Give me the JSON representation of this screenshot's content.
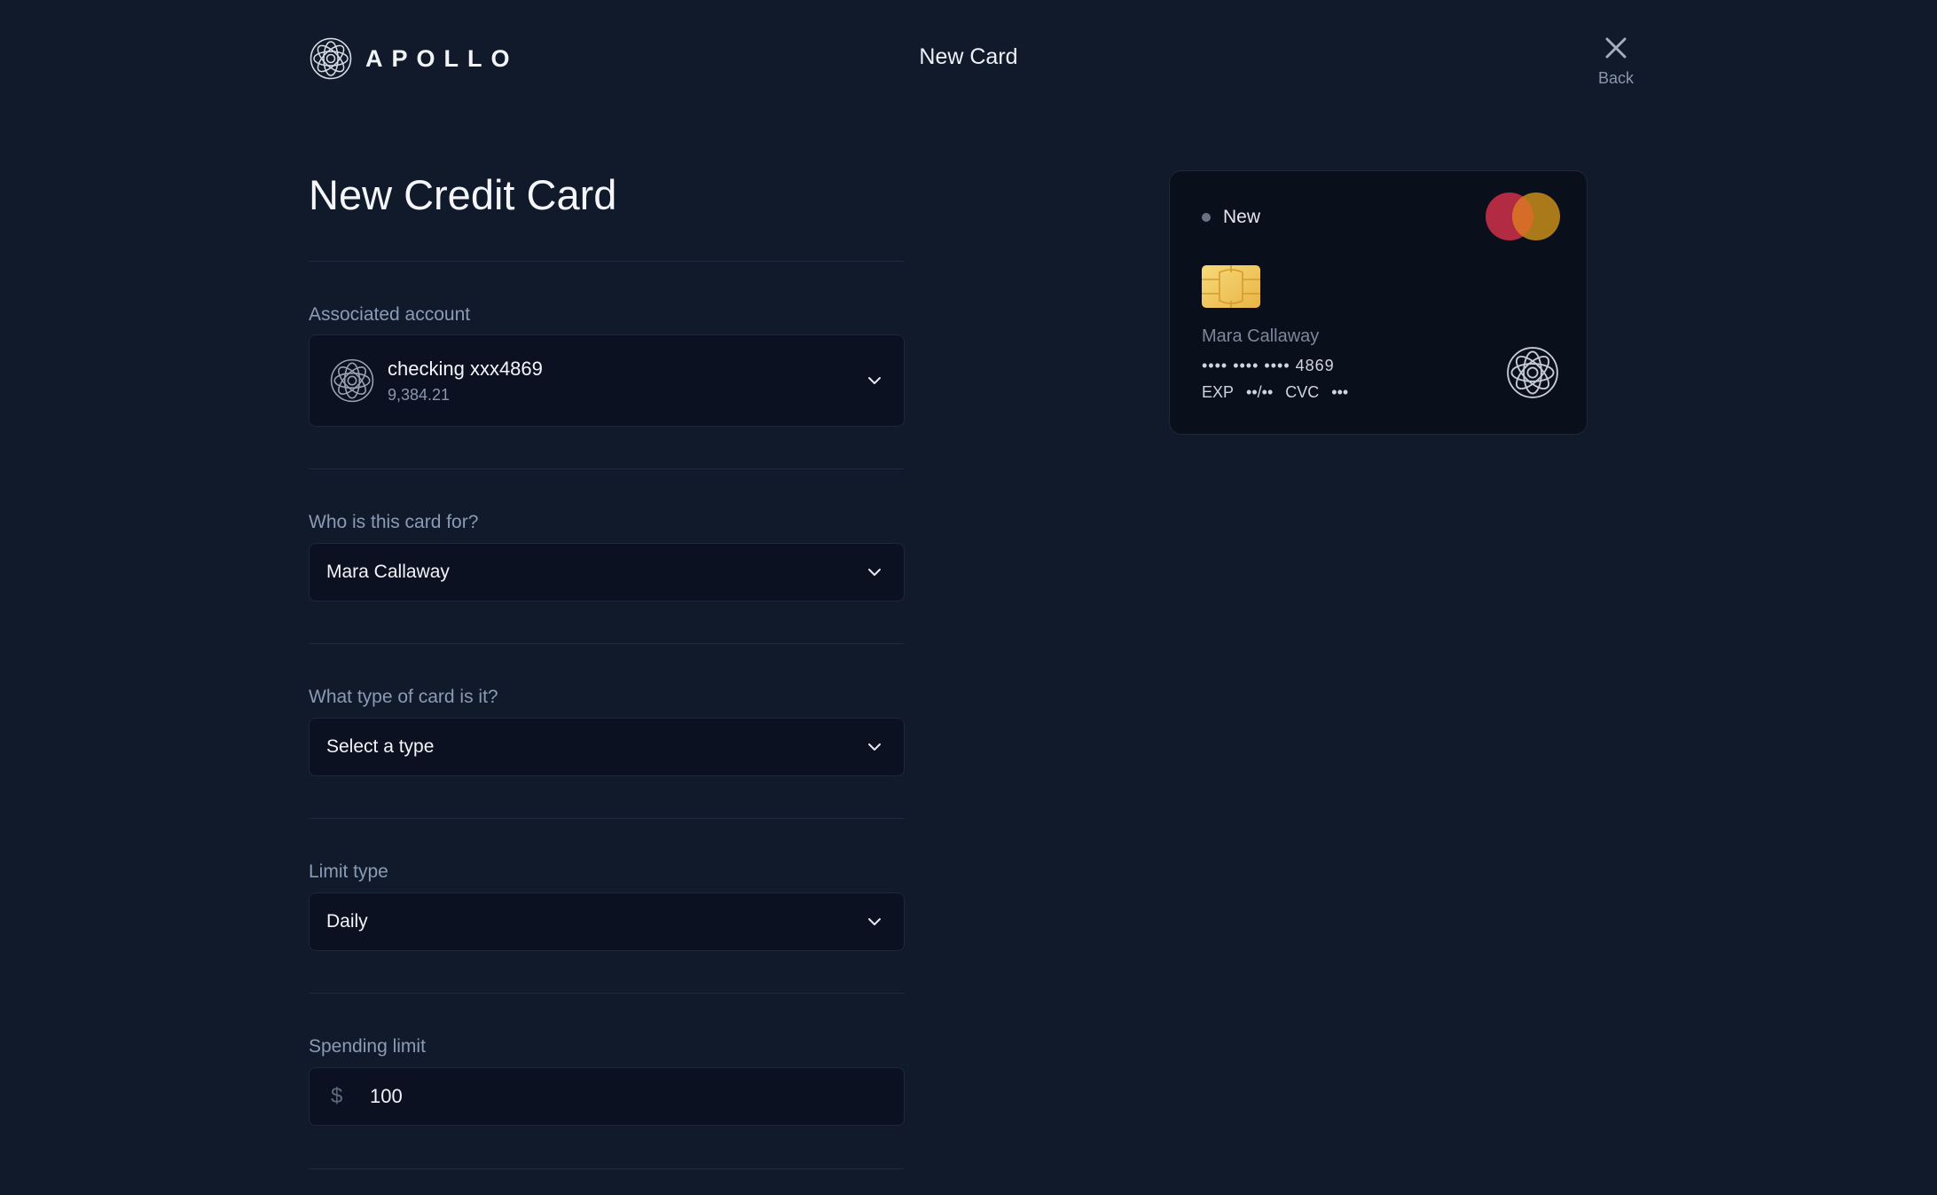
{
  "brand": {
    "name": "APOLLO",
    "logo_icon": "knot-logo-icon"
  },
  "header": {
    "title": "New Card",
    "back_label": "Back",
    "back_icon": "close-icon"
  },
  "form": {
    "title": "New Credit Card",
    "account": {
      "label": "Associated account",
      "name": "checking xxx4869",
      "balance": "9,384.21"
    },
    "recipient": {
      "label": "Who is this card for?",
      "value": "Mara Callaway"
    },
    "card_type": {
      "label": "What type of card is it?",
      "value": "Select a type"
    },
    "limit_type": {
      "label": "Limit type",
      "value": "Daily"
    },
    "spending_limit": {
      "label": "Spending limit",
      "currency": "$",
      "value": "100"
    }
  },
  "card_preview": {
    "status": "New",
    "holder": "Mara Callaway",
    "number": "•••• •••• •••• 4869",
    "exp_label": "EXP",
    "exp_value": "••/••",
    "cvc_label": "CVC",
    "cvc_value": "•••",
    "network_icon": "mastercard-icon"
  },
  "colors": {
    "background": "#111a2b",
    "panel": "#0b1120",
    "muted_text": "#8a9bb5",
    "mastercard_red": "#b32a43",
    "mastercard_yellow": "#c8901c"
  }
}
